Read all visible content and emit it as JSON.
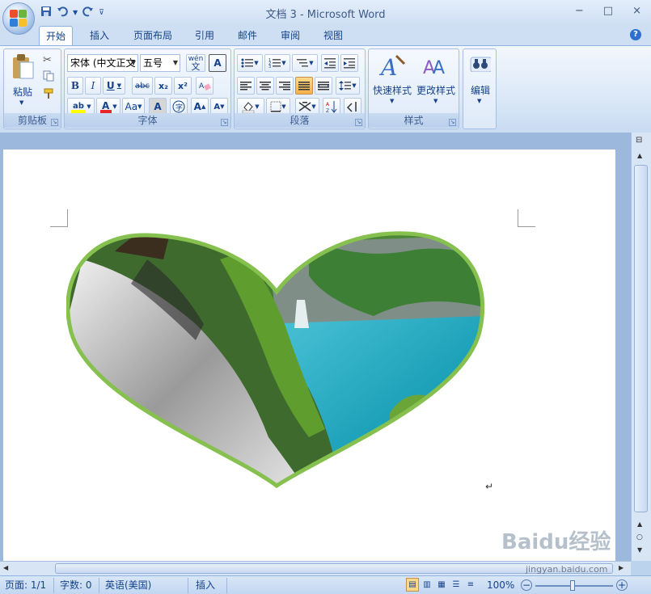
{
  "window": {
    "title": "文档 3 - Microsoft Word",
    "controls": [
      "−",
      "□",
      "×"
    ]
  },
  "tabs": [
    "开始",
    "插入",
    "页面布局",
    "引用",
    "邮件",
    "审阅",
    "视图"
  ],
  "active_tab": "开始",
  "ribbon": {
    "clipboard": {
      "label": "剪贴板",
      "paste": "粘贴"
    },
    "font": {
      "label": "字体",
      "font_name": "宋体 (中文正文",
      "font_size": "五号",
      "bold": "B",
      "italic": "I",
      "underline": "U",
      "strike": "abc",
      "subscript": "x₂",
      "superscript": "x²",
      "change_case": "Aa",
      "char_border": "A",
      "grow": "A",
      "shrink": "A",
      "wen": "wén",
      "wen2": "文"
    },
    "paragraph": {
      "label": "段落"
    },
    "styles": {
      "label": "样式",
      "quick": "快速样式",
      "change": "更改样式"
    },
    "editing": {
      "label": "编辑"
    }
  },
  "status": {
    "page": "页面: 1/1",
    "words": "字数: 0",
    "language": "英语(美国)",
    "mode": "插入",
    "zoom": "100%"
  },
  "watermark": {
    "text": "Baidu经验",
    "url": "jingyan.baidu.com"
  }
}
